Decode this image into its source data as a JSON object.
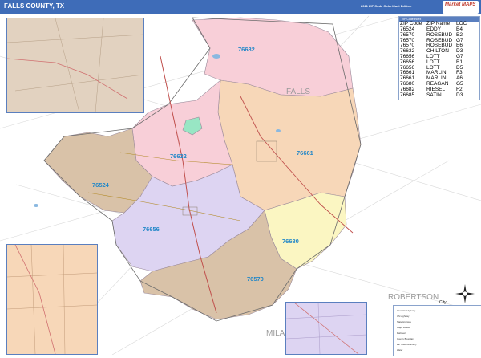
{
  "header": {
    "title": "FALLS COUNTY, TX",
    "subtitle": "2021 ZIP Code Color/Cast Edition",
    "logo_text": "Market MAPS"
  },
  "colors": {
    "title_bar": "#3e6cb8",
    "zip_76682": "#f8cfd8",
    "zip_76661": "#f7d7b8",
    "zip_76632": "#f8cfd8",
    "zip_76524": "#d9c2a8",
    "zip_76656": "#ddd4f2",
    "zip_76680": "#fbf6c2",
    "zip_76570": "#d9c2a8",
    "zip_76524_small": "#98e6c4"
  },
  "zip_labels": [
    {
      "zip": "76682"
    },
    {
      "zip": "76661"
    },
    {
      "zip": "76632"
    },
    {
      "zip": "76524"
    },
    {
      "zip": "76656"
    },
    {
      "zip": "76680"
    },
    {
      "zip": "76570"
    }
  ],
  "county_labels": [
    "FALLS",
    "ROBERTSON",
    "MILA"
  ],
  "legend": {
    "caption": "ZIP Code Index",
    "headers": [
      "ZIP Code",
      "ZIP Name",
      "LOC"
    ],
    "rows": [
      [
        "76524",
        "EDDY",
        "B4"
      ],
      [
        "76570",
        "ROSEBUD",
        "B2"
      ],
      [
        "76570",
        "ROSEBUD",
        "G7"
      ],
      [
        "76570",
        "ROSEBUD",
        "E6"
      ],
      [
        "76632",
        "CHILTON",
        "D3"
      ],
      [
        "76656",
        "LOTT",
        "G7"
      ],
      [
        "76656",
        "LOTT",
        "B1"
      ],
      [
        "76656",
        "LOTT",
        "D5"
      ],
      [
        "76661",
        "MARLIN",
        "F3"
      ],
      [
        "76661",
        "MARLIN",
        "A6"
      ],
      [
        "76680",
        "REAGAN",
        "G5"
      ],
      [
        "76682",
        "RIESEL",
        "F2"
      ],
      [
        "76685",
        "SATIN",
        "D3"
      ]
    ]
  },
  "map_key": {
    "city_label": "City",
    "row_labels": [
      "Interstate Highway",
      "US Highway",
      "State Highway",
      "Major Roads",
      "Railroad",
      "County Boundary",
      "ZIP Code Boundary",
      "Water"
    ]
  },
  "compass": {
    "label": "N"
  }
}
